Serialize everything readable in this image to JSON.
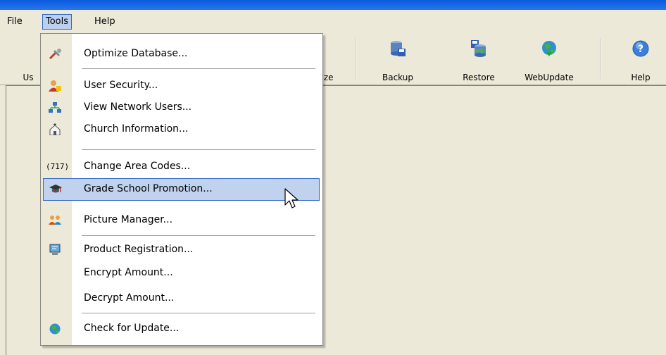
{
  "menubar": {
    "items": [
      {
        "label": "File"
      },
      {
        "label": "Tools"
      },
      {
        "label": "Help"
      }
    ]
  },
  "toolbar": {
    "buttons": [
      {
        "label": "Us",
        "icon": "user-icon"
      },
      {
        "label": "ize",
        "icon": "optimize-icon"
      },
      {
        "label": "Backup",
        "icon": "database-backup-icon"
      },
      {
        "label": "Restore",
        "icon": "database-restore-icon"
      },
      {
        "label": "WebUpdate",
        "icon": "globe-update-icon"
      },
      {
        "label": "Help",
        "icon": "help-icon"
      }
    ]
  },
  "tools_menu": {
    "items": [
      {
        "label": "Optimize Database...",
        "icon": "wrench-tools-icon"
      },
      {
        "label": "User Security...",
        "icon": "user-lock-icon"
      },
      {
        "label": "View Network Users...",
        "icon": "network-icon"
      },
      {
        "label": "Church Information...",
        "icon": "church-icon"
      },
      {
        "label": "Change Area Codes...",
        "icon_text": "(717)"
      },
      {
        "label": "Grade School Promotion...",
        "icon": "graduation-cap-icon"
      },
      {
        "label": "Picture Manager...",
        "icon": "people-icon"
      },
      {
        "label": "Product Registration...",
        "icon": "registration-icon"
      },
      {
        "label": "Encrypt Amount..."
      },
      {
        "label": "Decrypt Amount..."
      },
      {
        "label": "Check for Update...",
        "icon": "globe-icon"
      }
    ]
  },
  "colors": {
    "highlight_bg": "#c1d2ee",
    "highlight_border": "#316ac5",
    "menu_face": "#ece9d8"
  }
}
